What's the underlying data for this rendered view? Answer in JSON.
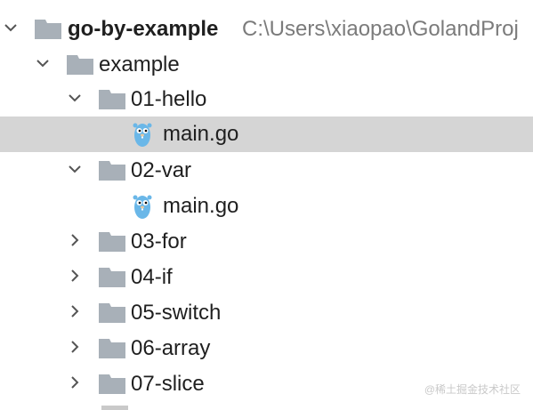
{
  "tree": {
    "root": {
      "label": "go-by-example",
      "path": "C:\\Users\\xiaopao\\GolandProj"
    },
    "example": {
      "label": "example"
    },
    "folders": [
      {
        "label": "01-hello",
        "expanded": true
      },
      {
        "label": "02-var",
        "expanded": true
      },
      {
        "label": "03-for",
        "expanded": false
      },
      {
        "label": "04-if",
        "expanded": false
      },
      {
        "label": "05-switch",
        "expanded": false
      },
      {
        "label": "06-array",
        "expanded": false
      },
      {
        "label": "07-slice",
        "expanded": false
      }
    ],
    "files": [
      {
        "label": "main.go",
        "selected": true,
        "icon": "gopher-icon"
      },
      {
        "label": "main.go",
        "selected": false,
        "icon": "gopher-icon"
      }
    ]
  },
  "watermark": "@稀土掘金技术社区",
  "colors": {
    "selection": "#d5d5d5",
    "folder": "#a8b0b8",
    "gopher": "#6ab7e8",
    "chevron": "#555555",
    "path_text": "#7b7b7b"
  }
}
